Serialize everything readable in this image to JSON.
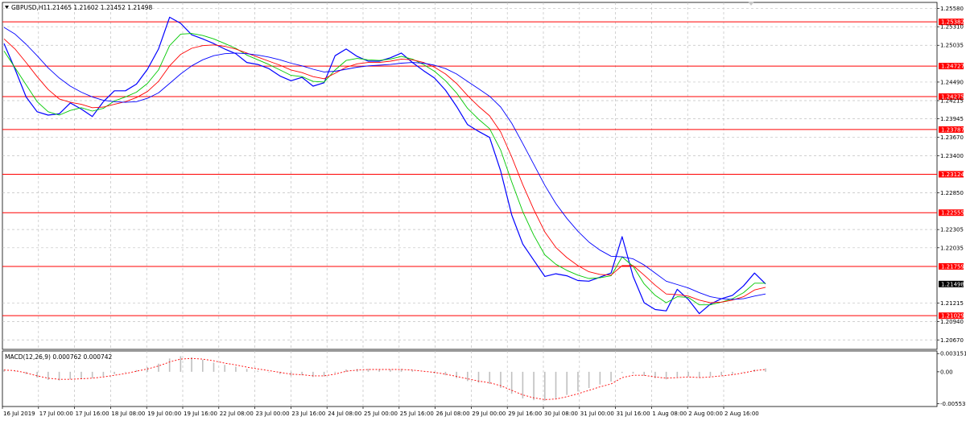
{
  "header": {
    "symbol": "GBPUSD,H1",
    "ohlc": "1.21465 1.21602 1.21452 1.21498",
    "menu_arrow": "triangle-down-icon"
  },
  "indicator": {
    "label": "MACD(12,26,9) 0.000762 0.000742"
  },
  "colors": {
    "background": "#ffffff",
    "price_line": "#0000ff",
    "ma_fast": "#00c800",
    "ma_mid": "#ff0000",
    "ma_slow": "#0000ff",
    "level_line": "#ff0000",
    "level_tag": "#ff0000",
    "current_tag": "#000000",
    "grid": "#c0c0c0",
    "histogram": "#c0c0c0",
    "signal": "#ff0000"
  },
  "chart_data": {
    "type": "line",
    "title": "",
    "xlabel": "",
    "ylabel": "",
    "grid": true,
    "ylim": [
      1.2053,
      1.2567
    ],
    "price_axis_ticks": [
      "1.25580",
      "1.25310",
      "1.25035",
      "1.24490",
      "1.24215",
      "1.23945",
      "1.23670",
      "1.23400",
      "1.22850",
      "1.22305",
      "1.22035",
      "1.21215",
      "1.20940",
      "1.20670"
    ],
    "time_labels": [
      "16 Jul 2019",
      "17 Jul 00:00",
      "17 Jul 16:00",
      "18 Jul 08:00",
      "19 Jul 00:00",
      "19 Jul 16:00",
      "22 Jul 08:00",
      "23 Jul 00:00",
      "23 Jul 16:00",
      "24 Jul 08:00",
      "25 Jul 00:00",
      "25 Jul 16:00",
      "26 Jul 08:00",
      "29 Jul 00:00",
      "29 Jul 16:00",
      "30 Jul 08:00",
      "31 Jul 00:00",
      "31 Jul 16:00",
      "1 Aug 08:00",
      "2 Aug 00:00",
      "2 Aug 16:00"
    ],
    "levels": [
      "1.25382",
      "1.24727",
      "1.24275",
      "1.23787",
      "1.23124",
      "1.22555",
      "1.21759",
      "1.21029"
    ],
    "current_price": "1.21498",
    "series": [
      {
        "values": [
          1.2506,
          1.2468,
          1.2427,
          1.2405,
          1.24,
          1.2402,
          1.2418,
          1.2409,
          1.2398,
          1.242,
          1.2436,
          1.2436,
          1.2446,
          1.2468,
          1.2498,
          1.2545,
          1.2536,
          1.2519,
          1.2513,
          1.2506,
          1.2498,
          1.2491,
          1.2478,
          1.2475,
          1.2469,
          1.2458,
          1.2451,
          1.2456,
          1.2443,
          1.2448,
          1.2488,
          1.2498,
          1.2487,
          1.248,
          1.248,
          1.2485,
          1.2492,
          1.2478,
          1.2466,
          1.2455,
          1.2437,
          1.2413,
          1.2386,
          1.2376,
          1.2367,
          1.2317,
          1.2252,
          1.2209,
          1.2185,
          1.2161,
          1.2165,
          1.2162,
          1.2155,
          1.2154,
          1.216,
          1.2166,
          1.222,
          1.2161,
          1.2122,
          1.2112,
          1.211,
          1.2142,
          1.2127,
          1.2106,
          1.212,
          1.2128,
          1.2133,
          1.2147,
          1.2166,
          1.215
        ]
      },
      {
        "values": [
          1.2495,
          1.247,
          1.2445,
          1.242,
          1.2405,
          1.24,
          1.2407,
          1.2411,
          1.2406,
          1.241,
          1.2421,
          1.2427,
          1.2434,
          1.2447,
          1.2467,
          1.2503,
          1.252,
          1.2521,
          1.2518,
          1.2513,
          1.2506,
          1.2499,
          1.2489,
          1.2482,
          1.2475,
          1.2467,
          1.2459,
          1.2457,
          1.245,
          1.2449,
          1.2467,
          1.2481,
          1.2484,
          1.2482,
          1.2481,
          1.2483,
          1.2487,
          1.2483,
          1.2475,
          1.2465,
          1.2451,
          1.2433,
          1.241,
          1.2394,
          1.238,
          1.2348,
          1.2301,
          1.2257,
          1.2222,
          1.2193,
          1.2179,
          1.217,
          1.2163,
          1.2158,
          1.2159,
          1.2162,
          1.219,
          1.2176,
          1.215,
          1.2133,
          1.2122,
          1.2131,
          1.213,
          1.2119,
          1.2119,
          1.2123,
          1.2128,
          1.2137,
          1.2151,
          1.2151
        ]
      },
      {
        "values": [
          1.2513,
          1.2498,
          1.2478,
          1.2457,
          1.2438,
          1.2424,
          1.2419,
          1.2416,
          1.2411,
          1.2412,
          1.2416,
          1.242,
          1.2426,
          1.2435,
          1.245,
          1.2473,
          1.249,
          1.2499,
          1.2503,
          1.2504,
          1.2502,
          1.2498,
          1.2492,
          1.2486,
          1.248,
          1.2474,
          1.2467,
          1.2463,
          1.2457,
          1.2454,
          1.2462,
          1.2471,
          1.2476,
          1.2478,
          1.2478,
          1.248,
          1.2483,
          1.2482,
          1.2478,
          1.2471,
          1.2461,
          1.2447,
          1.2429,
          1.2413,
          1.2399,
          1.2375,
          1.2338,
          1.2297,
          1.226,
          1.2227,
          1.2204,
          1.2189,
          1.2177,
          1.2168,
          1.2164,
          1.2163,
          1.2177,
          1.2177,
          1.2163,
          1.2148,
          1.2135,
          1.2134,
          1.2132,
          1.2126,
          1.2122,
          1.2123,
          1.2126,
          1.2131,
          1.2141,
          1.2145
        ]
      },
      {
        "values": [
          1.253,
          1.252,
          1.2505,
          1.2488,
          1.247,
          1.2455,
          1.2443,
          1.2434,
          1.2427,
          1.2422,
          1.242,
          1.2419,
          1.242,
          1.2425,
          1.2433,
          1.2447,
          1.2461,
          1.2473,
          1.2482,
          1.2488,
          1.2491,
          1.2492,
          1.2491,
          1.2489,
          1.2486,
          1.2482,
          1.2477,
          1.2473,
          1.2468,
          1.2464,
          1.2465,
          1.2468,
          1.2471,
          1.2473,
          1.2474,
          1.2475,
          1.2477,
          1.2478,
          1.2477,
          1.2474,
          1.2469,
          1.2461,
          1.245,
          1.2439,
          1.2428,
          1.2412,
          1.2388,
          1.2358,
          1.2327,
          1.2296,
          1.2269,
          1.2247,
          1.2228,
          1.2212,
          1.22,
          1.2191,
          1.219,
          1.2187,
          1.2178,
          1.2166,
          1.2154,
          1.2149,
          1.2144,
          1.2137,
          1.2131,
          1.2128,
          1.2127,
          1.2128,
          1.2132,
          1.2135
        ]
      }
    ],
    "macd_ylim": [
      -0.006,
      0.0036
    ],
    "macd_ticks": [
      "0.003151",
      "0.00",
      "-0.005531"
    ],
    "macd": {
      "histogram": [
        0.0004,
        0.0001,
        -0.0004,
        -0.001,
        -0.0014,
        -0.0015,
        -0.0013,
        -0.0012,
        -0.0011,
        -0.0008,
        -0.0004,
        -0.0001,
        0.0003,
        0.0008,
        0.0014,
        0.0023,
        0.0027,
        0.0025,
        0.0021,
        0.0016,
        0.0012,
        0.0009,
        0.0005,
        0.0002,
        -0.0001,
        -0.0004,
        -0.0007,
        -0.0006,
        -0.0009,
        -0.0008,
        -0.0002,
        0.0004,
        0.0005,
        0.0005,
        0.0004,
        0.0004,
        0.0005,
        0.0003,
        0.0,
        -0.0003,
        -0.0006,
        -0.0011,
        -0.0016,
        -0.0019,
        -0.0021,
        -0.0028,
        -0.0038,
        -0.0046,
        -0.0049,
        -0.005,
        -0.0046,
        -0.004,
        -0.0034,
        -0.0028,
        -0.0022,
        -0.0017,
        -0.0002,
        -0.0003,
        -0.0007,
        -0.0011,
        -0.0013,
        -0.0009,
        -0.0008,
        -0.001,
        -0.0008,
        -0.0006,
        -0.0004,
        -0.0001,
        0.0004,
        0.0006
      ],
      "signal": [
        0.0003,
        0.0002,
        -0.0002,
        -0.0007,
        -0.0011,
        -0.0013,
        -0.0013,
        -0.0012,
        -0.0011,
        -0.0009,
        -0.0006,
        -0.0003,
        0.0001,
        0.0005,
        0.001,
        0.0017,
        0.0022,
        0.0023,
        0.0022,
        0.0019,
        0.0015,
        0.0012,
        0.0008,
        0.0005,
        0.0002,
        -0.0001,
        -0.0004,
        -0.0005,
        -0.0007,
        -0.0007,
        -0.0004,
        0.0001,
        0.0003,
        0.0004,
        0.0004,
        0.0004,
        0.0004,
        0.0003,
        0.0001,
        -0.0001,
        -0.0004,
        -0.0008,
        -0.0012,
        -0.0016,
        -0.0019,
        -0.0024,
        -0.0032,
        -0.004,
        -0.0045,
        -0.0048,
        -0.0047,
        -0.0043,
        -0.0038,
        -0.0032,
        -0.0026,
        -0.0021,
        -0.001,
        -0.0006,
        -0.0006,
        -0.0009,
        -0.0011,
        -0.001,
        -0.0009,
        -0.001,
        -0.0009,
        -0.0007,
        -0.0005,
        -0.0002,
        0.0002,
        0.0004
      ]
    }
  }
}
